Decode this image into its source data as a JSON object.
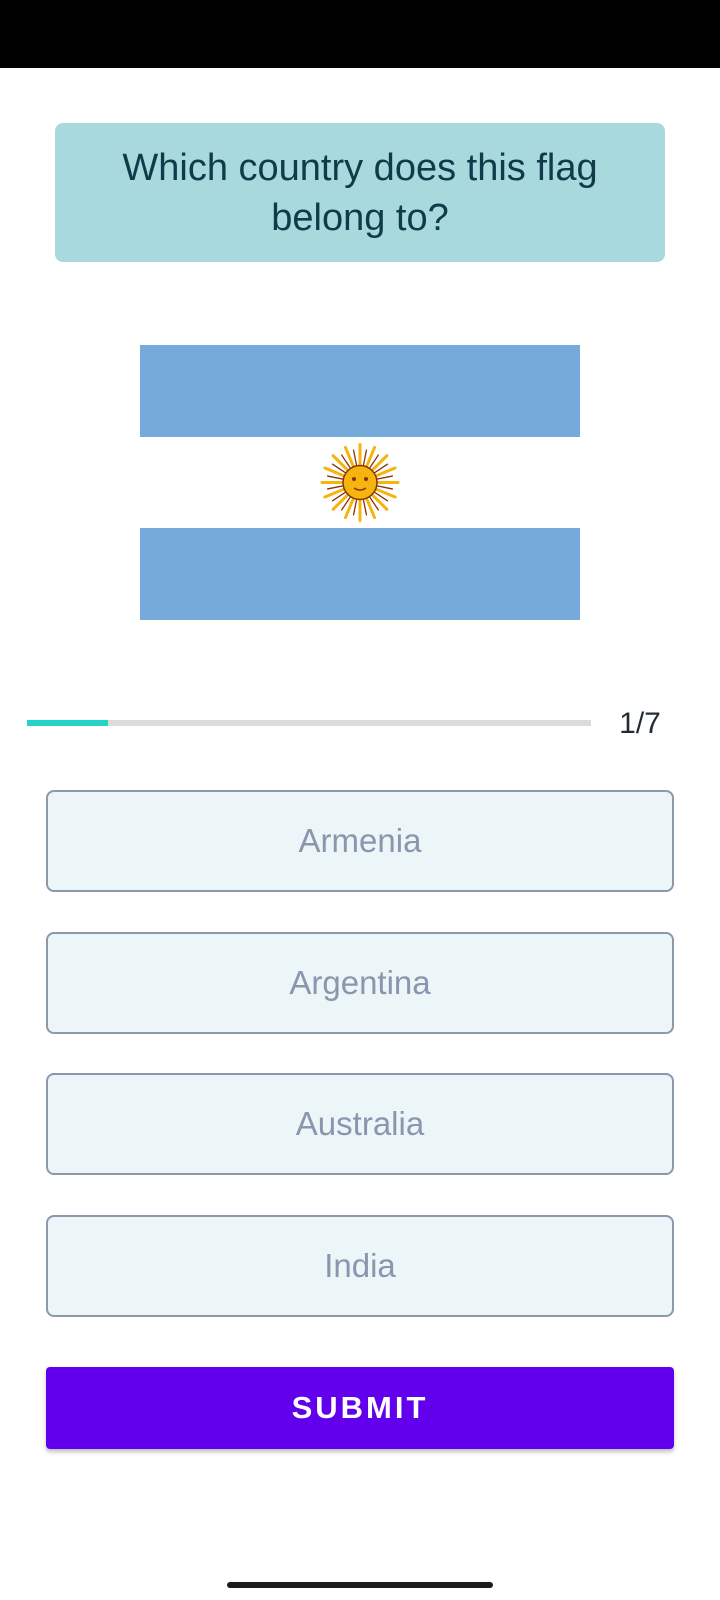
{
  "question": "Which country does this flag belong to?",
  "flag": {
    "icon": "argentina-flag",
    "stripe_color": "#75aadb",
    "sun_color": "#f6b40e",
    "sun_outline": "#85340a"
  },
  "progress": {
    "current": 1,
    "total": 7,
    "label": "1/7",
    "fraction": 0.143,
    "fill_color": "#23d3c6"
  },
  "options": [
    {
      "label": "Armenia"
    },
    {
      "label": "Argentina"
    },
    {
      "label": "Australia"
    },
    {
      "label": "India"
    }
  ],
  "submit": {
    "label": "SUBMIT",
    "color": "#6200ee"
  },
  "colors": {
    "question_card": "#a8d9dc",
    "question_text": "#113a4a",
    "option_background": "#ecf5f8",
    "option_border": "#8c98ab",
    "option_text": "#8a96ad"
  }
}
